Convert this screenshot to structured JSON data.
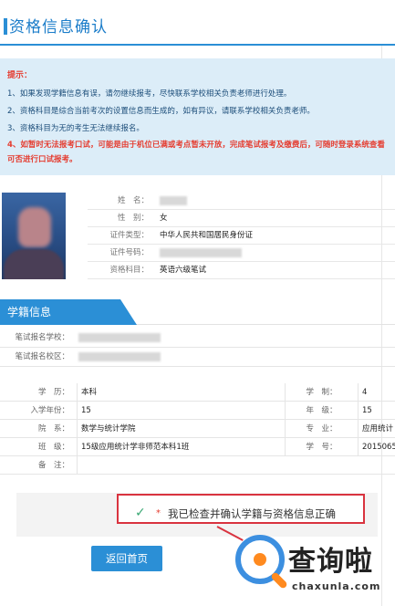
{
  "header": {
    "title": "资格信息确认"
  },
  "tips": {
    "title": "提示：",
    "items": [
      "1、如果发现学籍信息有误，请勿继续报考，尽快联系学校相关负责老师进行处理。",
      "2、资格科目是综合当前考次的设置信息而生成的，如有异议，请联系学校相关负责老师。",
      "3、资格科目为无的考生无法继续报名。"
    ],
    "warning": "4、如暂时无法报考口试，可能是由于机位已满或考点暂未开放，完成笔试报考及缴费后，可随时登录系统查看可否进行口试报考。"
  },
  "profile": {
    "rows": [
      {
        "label": "姓　名：",
        "value": ""
      },
      {
        "label": "性　别：",
        "value": "女"
      },
      {
        "label": "证件类型：",
        "value": "中华人民共和国居民身份证"
      },
      {
        "label": "证件号码：",
        "value": ""
      },
      {
        "label": "资格科目：",
        "value": "英语六级笔试"
      }
    ]
  },
  "section": {
    "title": "学籍信息"
  },
  "registration": {
    "rows": [
      {
        "label": "笔试报名学校：",
        "value": ""
      },
      {
        "label": "笔试报名校区：",
        "value": ""
      }
    ]
  },
  "grid": {
    "rows": [
      {
        "k1": "学　历：",
        "v1": "本科",
        "k2": "学　制：",
        "v2": "4"
      },
      {
        "k1": "入学年份：",
        "v1": "15",
        "k2": "年　级：",
        "v2": "15"
      },
      {
        "k1": "院　系：",
        "v1": "数学与统计学院",
        "k2": "专　业：",
        "v2": "应用统计"
      },
      {
        "k1": "班　级：",
        "v1": "15级应用统计学非师范本科1班",
        "k2": "学　号：",
        "v2": "2015065"
      },
      {
        "k1": "备　注：",
        "v1": "",
        "k2": "",
        "v2": ""
      }
    ]
  },
  "confirm": {
    "star": "*",
    "text": "我已检查并确认学籍与资格信息正确",
    "checked": true
  },
  "buttons": {
    "back": "返回首页"
  },
  "watermark": {
    "text": "查询啦",
    "url": "chaxunla.com"
  },
  "colors": {
    "accent": "#2b8fd6",
    "warning": "#e53c2f",
    "highlight_border": "#d9333f",
    "check": "#3aa874"
  }
}
